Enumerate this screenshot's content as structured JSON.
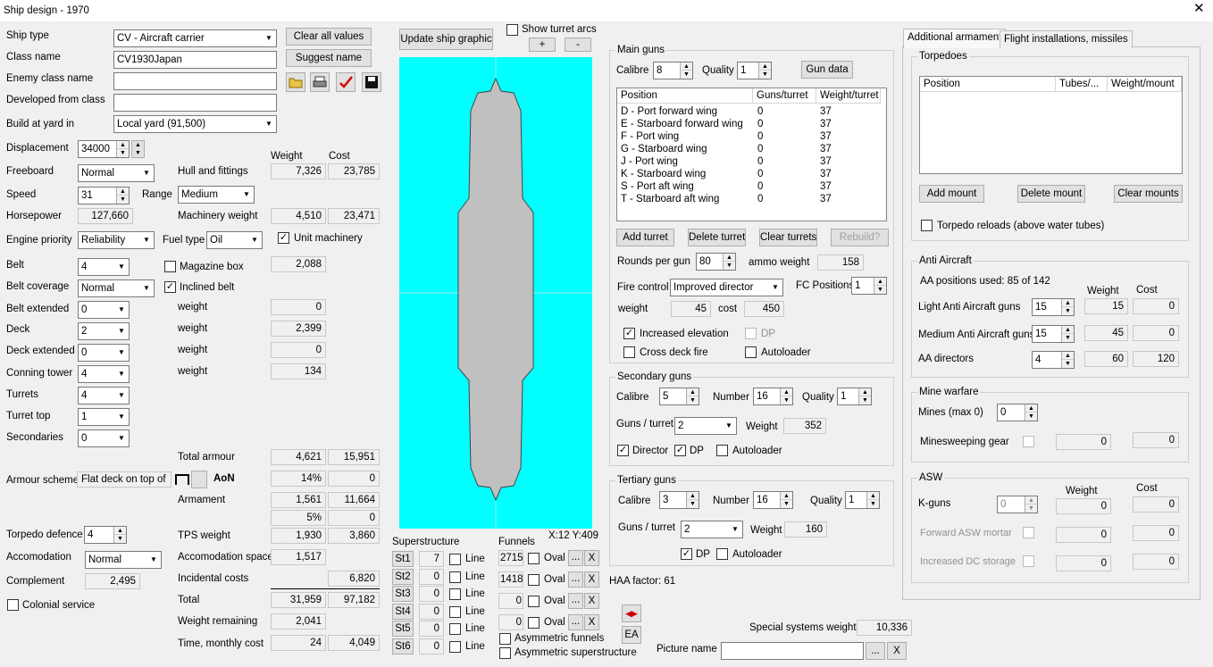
{
  "window": {
    "title": "Ship design - 1970"
  },
  "left": {
    "ship_type_label": "Ship type",
    "ship_type": "CV - Aircraft carrier",
    "class_name_label": "Class name",
    "class_name": "CV1930Japan",
    "enemy_class_label": "Enemy class name",
    "enemy_class": "",
    "developed_from_label": "Developed from class",
    "developed_from": "",
    "build_yard_label": "Build at yard in",
    "build_yard": "Local yard (91,500)",
    "clear_all": "Clear all values",
    "suggest_name": "Suggest name",
    "displacement_label": "Displacement",
    "displacement": "34000",
    "freeboard_label": "Freeboard",
    "freeboard": "Normal",
    "speed_label": "Speed",
    "speed": "31",
    "range_label": "Range",
    "range": "Medium",
    "horsepower_label": "Horsepower",
    "horsepower": "127,660",
    "engine_priority_label": "Engine priority",
    "engine_priority": "Reliability",
    "fuel_type_label": "Fuel type",
    "fuel_type": "Oil",
    "unit_machinery": "Unit machinery",
    "belt_label": "Belt",
    "belt": "4",
    "belt_coverage_label": "Belt coverage",
    "belt_coverage": "Normal",
    "belt_extended_label": "Belt extended",
    "belt_extended": "0",
    "deck_label": "Deck",
    "deck": "2",
    "deck_extended_label": "Deck extended",
    "deck_extended": "0",
    "conning_label": "Conning tower",
    "conning": "4",
    "turrets_label": "Turrets",
    "turrets": "4",
    "turret_top_label": "Turret top",
    "turret_top": "1",
    "secondaries_label": "Secondaries",
    "secondaries": "0",
    "armour_scheme_label": "Armour scheme",
    "armour_scheme": "Flat deck on top of",
    "aon": "AoN",
    "torpedo_defence_label": "Torpedo defence",
    "torpedo_defence": "4",
    "accomodation_label": "Accomodation",
    "accomodation": "Normal",
    "complement_label": "Complement",
    "complement": "2,495",
    "colonial": "Colonial service"
  },
  "mid": {
    "weight_hdr": "Weight",
    "cost_hdr": "Cost",
    "hull_label": "Hull and fittings",
    "hull_w": "7,326",
    "hull_c": "23,785",
    "mach_label": "Machinery weight",
    "mach_w": "4,510",
    "mach_c": "23,471",
    "magazine_box": "Magazine box",
    "magazine_w": "2,088",
    "inclined_belt": "Inclined belt",
    "weight_label": "weight",
    "w1": "0",
    "w2": "2,399",
    "w3": "0",
    "w4": "134",
    "total_armour_label": "Total armour",
    "ta_w": "4,621",
    "ta_c": "15,951",
    "ta_pct": "14%",
    "ta_pc": "0",
    "armament_label": "Armament",
    "arm_w": "1,561",
    "arm_c": "11,664",
    "arm_pct": "5%",
    "arm_pc": "0",
    "tps_label": "TPS weight",
    "tps_w": "1,930",
    "tps_c": "3,860",
    "accspace_label": "Accomodation space",
    "acc_w": "1,517",
    "incidental_label": "Incidental costs",
    "inc_c": "6,820",
    "total_label": "Total",
    "tot_w": "31,959",
    "tot_c": "97,182",
    "remaining_label": "Weight remaining",
    "rem_w": "2,041",
    "time_label": "Time, monthly cost",
    "time_w": "24",
    "time_c": "4,049"
  },
  "graphic": {
    "update": "Update ship graphic",
    "show_arcs": "Show turret arcs",
    "plus": "+",
    "minus": "-",
    "coords": "X:12 Y:409"
  },
  "superstructure": {
    "label": "Superstructure",
    "line": "Line",
    "rows": [
      {
        "btn": "St1",
        "val": "7"
      },
      {
        "btn": "St2",
        "val": "0"
      },
      {
        "btn": "St3",
        "val": "0"
      },
      {
        "btn": "St4",
        "val": "0"
      },
      {
        "btn": "St5",
        "val": "0"
      },
      {
        "btn": "St6",
        "val": "0"
      }
    ]
  },
  "funnels": {
    "label": "Funnels",
    "oval": "Oval",
    "dots": "...",
    "x": "X",
    "rows": [
      {
        "val": "2715"
      },
      {
        "val": "1418"
      },
      {
        "val": "0"
      },
      {
        "val": "0"
      }
    ],
    "asym_funnels": "Asymmetric funnels",
    "asym_super": "Asymmetric superstructure"
  },
  "main_guns": {
    "title": "Main guns",
    "calibre_label": "Calibre",
    "calibre": "8",
    "quality_label": "Quality",
    "quality": "1",
    "gun_data": "Gun data",
    "headers": [
      "Position",
      "Guns/turret",
      "Weight/turret"
    ],
    "rows": [
      [
        "D - Port forward wing",
        "0",
        "37"
      ],
      [
        "E - Starboard forward wing",
        "0",
        "37"
      ],
      [
        "F - Port wing",
        "0",
        "37"
      ],
      [
        "G - Starboard wing",
        "0",
        "37"
      ],
      [
        "J - Port wing",
        "0",
        "37"
      ],
      [
        "K - Starboard wing",
        "0",
        "37"
      ],
      [
        "S - Port aft wing",
        "0",
        "37"
      ],
      [
        "T - Starboard aft wing",
        "0",
        "37"
      ]
    ],
    "add_turret": "Add turret",
    "delete_turret": "Delete turret",
    "clear_turrets": "Clear turrets",
    "rebuild": "Rebuild?",
    "rounds_label": "Rounds per gun",
    "rounds": "80",
    "ammo_label": "ammo weight",
    "ammo": "158",
    "fire_control_label": "Fire control",
    "fire_control": "Improved director",
    "fc_positions_label": "FC Positions",
    "fc_positions": "1",
    "weight_label": "weight",
    "weight": "45",
    "cost_label": "cost",
    "cost": "450",
    "increased_elev": "Increased elevation",
    "dp": "DP",
    "cross_deck": "Cross deck fire",
    "autoloader": "Autoloader"
  },
  "secondary": {
    "title": "Secondary guns",
    "calibre_label": "Calibre",
    "calibre": "5",
    "number_label": "Number",
    "number": "16",
    "quality_label": "Quality",
    "quality": "1",
    "gpt_label": "Guns / turret",
    "gpt": "2",
    "weight_label": "Weight",
    "weight": "352",
    "director": "Director",
    "dp": "DP",
    "autoloader": "Autoloader"
  },
  "tertiary": {
    "title": "Tertiary guns",
    "calibre_label": "Calibre",
    "calibre": "3",
    "number_label": "Number",
    "number": "16",
    "quality_label": "Quality",
    "quality": "1",
    "gpt_label": "Guns / turret",
    "gpt": "2",
    "weight_label": "Weight",
    "weight": "160",
    "dp": "DP",
    "autoloader": "Autoloader"
  },
  "bottom": {
    "haa": "HAA factor: 61",
    "ea": "EA",
    "special_label": "Special systems weight",
    "special": "10,336",
    "picture_label": "Picture name",
    "picture": "",
    "dots": "...",
    "x": "X"
  },
  "tabs": {
    "additional": "Additional armament",
    "flight": "Flight installations, missiles"
  },
  "torpedoes": {
    "title": "Torpedoes",
    "headers": [
      "Position",
      "Tubes/...",
      "Weight/mount"
    ],
    "add": "Add mount",
    "delete": "Delete mount",
    "clear": "Clear mounts",
    "reloads": "Torpedo reloads (above water tubes)"
  },
  "aa": {
    "title": "Anti Aircraft",
    "positions": "AA positions used: 85 of 142",
    "weight_hdr": "Weight",
    "cost_hdr": "Cost",
    "light_label": "Light Anti Aircraft guns",
    "light": "15",
    "light_w": "15",
    "light_c": "0",
    "medium_label": "Medium Anti Aircraft guns",
    "medium": "15",
    "medium_w": "45",
    "medium_c": "0",
    "dir_label": "AA directors",
    "dir": "4",
    "dir_w": "60",
    "dir_c": "120"
  },
  "mine": {
    "title": "Mine warfare",
    "mines_label": "Mines (max 0)",
    "mines": "0",
    "sweep_label": "Minesweeping gear",
    "sweep_w": "0",
    "sweep_c": "0"
  },
  "asw": {
    "title": "ASW",
    "weight_hdr": "Weight",
    "cost_hdr": "Cost",
    "kguns_label": "K-guns",
    "kguns": "0",
    "kguns_w": "0",
    "kguns_c": "0",
    "mortar_label": "Forward ASW mortar",
    "mortar_w": "0",
    "mortar_c": "0",
    "dc_label": "Increased DC storage",
    "dc_w": "0",
    "dc_c": "0"
  }
}
